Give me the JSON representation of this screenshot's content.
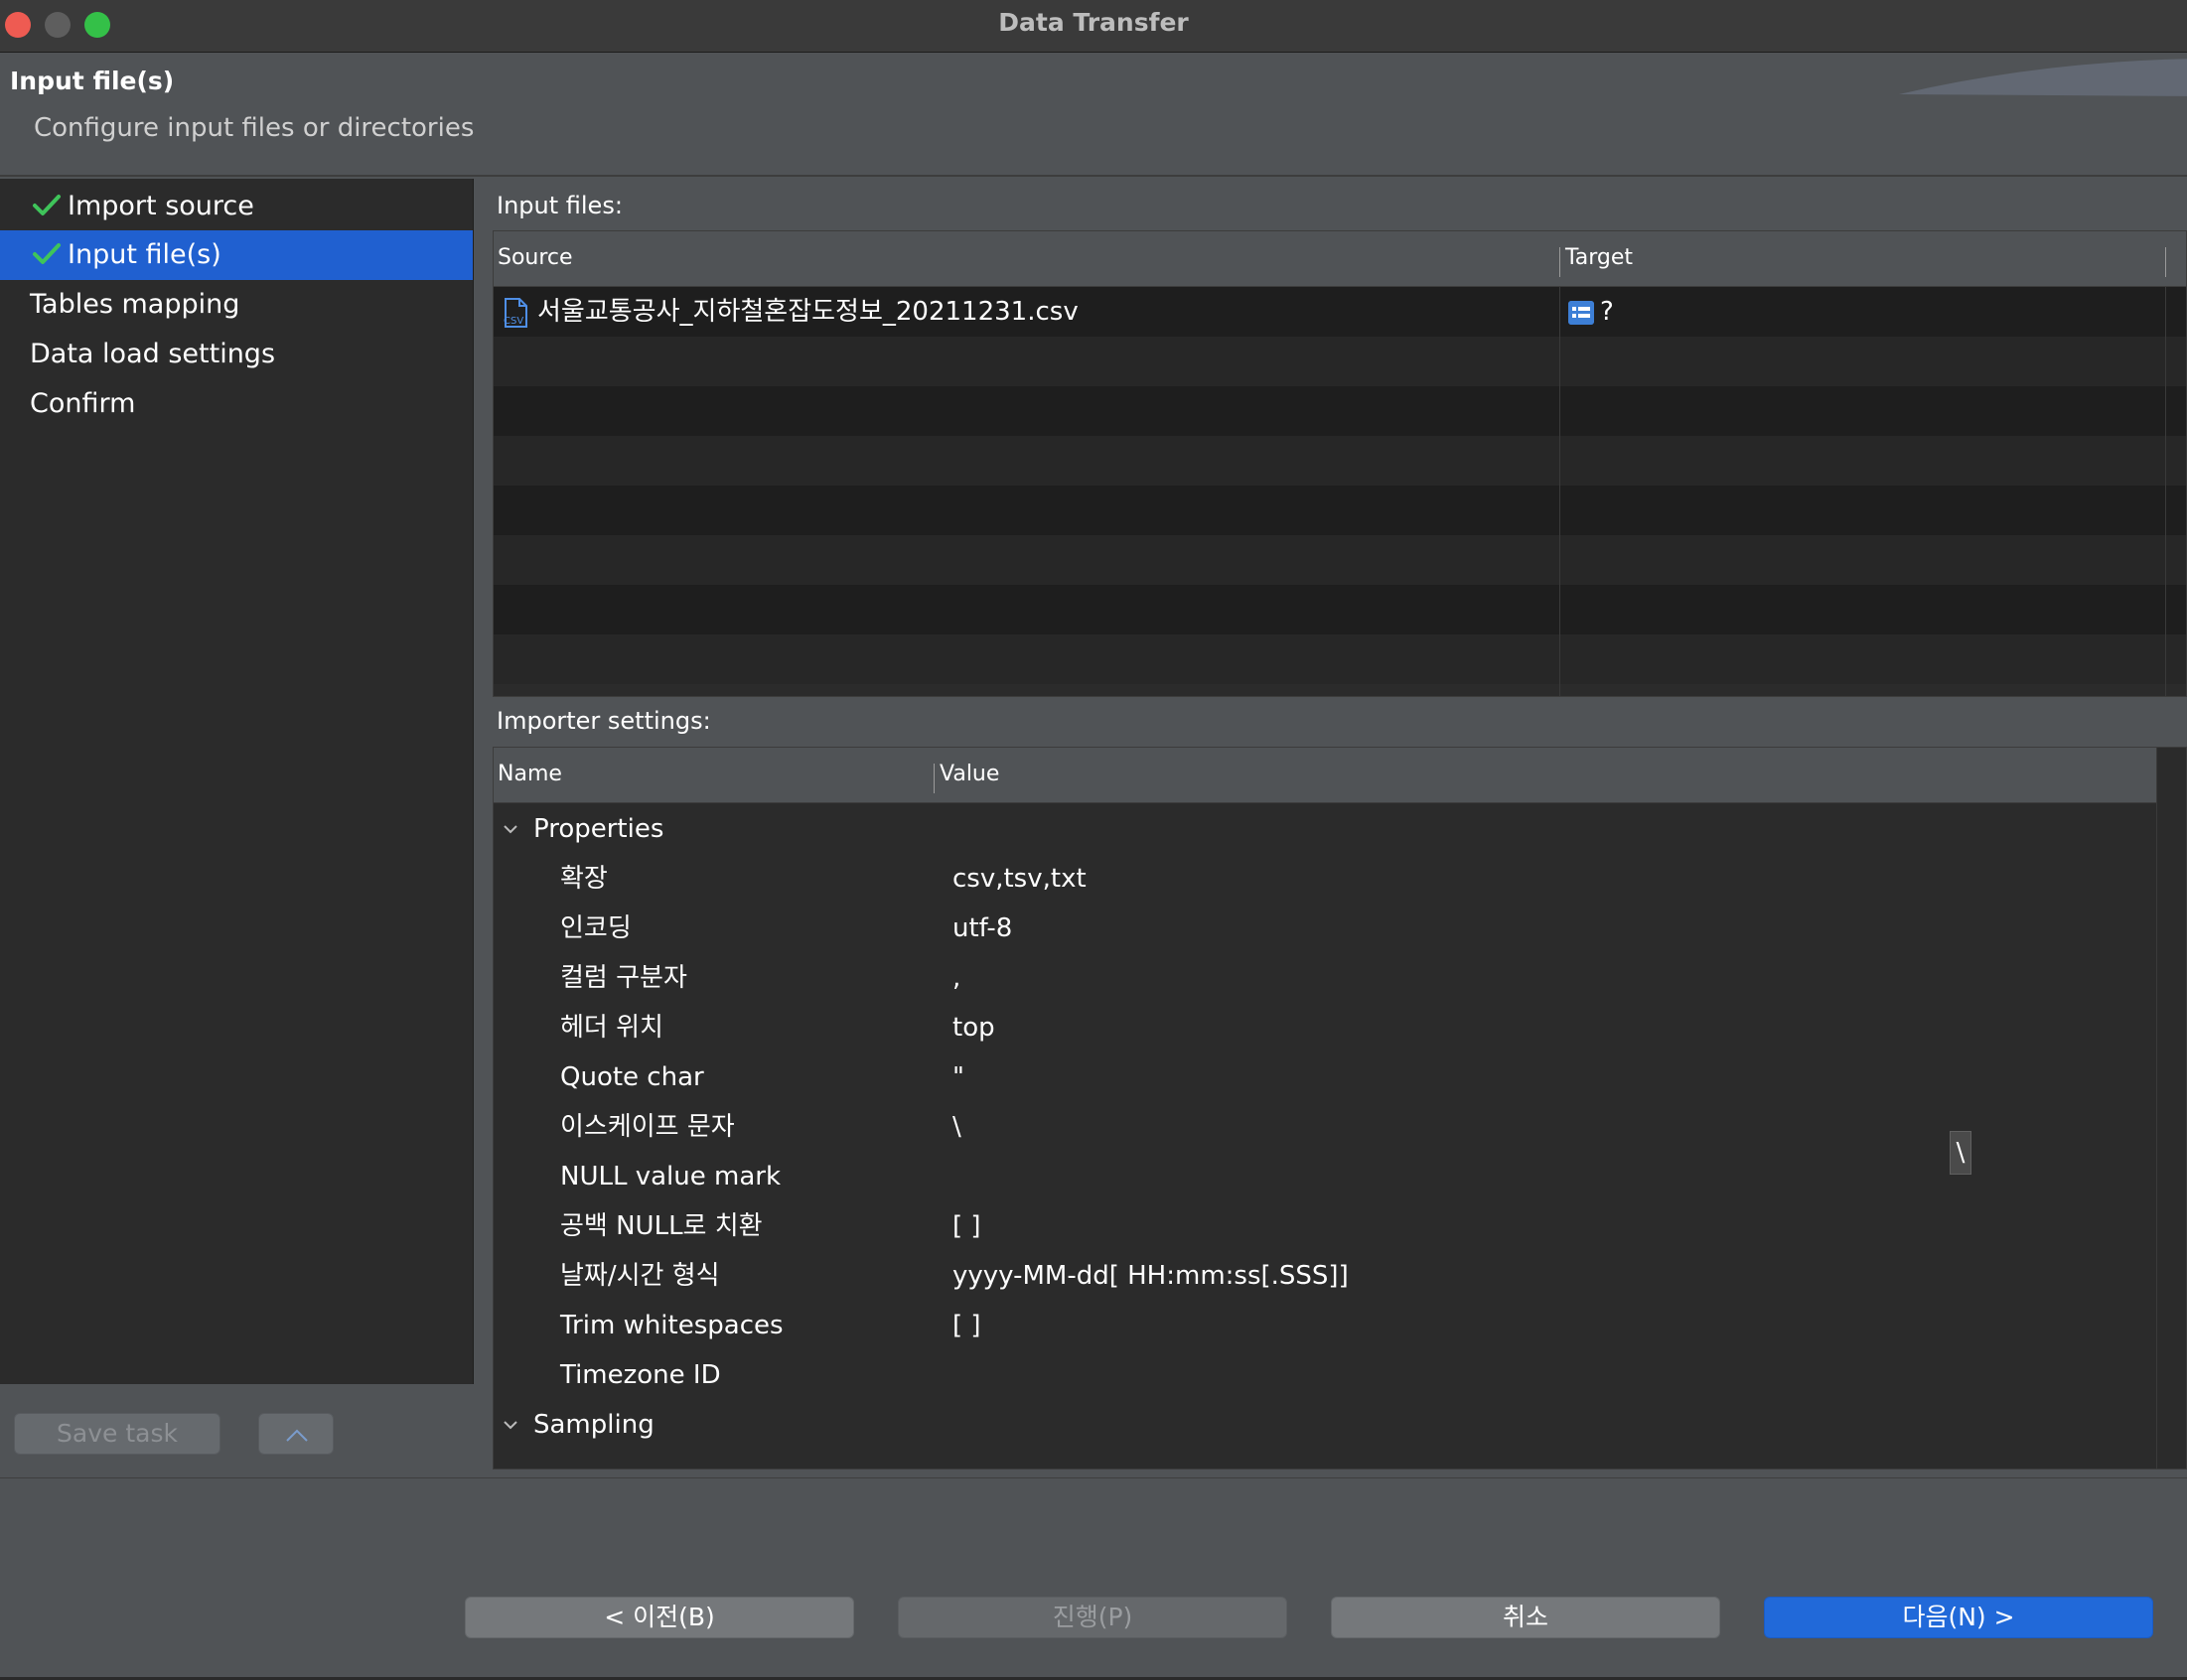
{
  "window": {
    "title": "Data Transfer"
  },
  "header": {
    "title": "Input file(s)",
    "description": "Configure input files or directories"
  },
  "nav": {
    "items": [
      {
        "label": "Import source",
        "done": true
      },
      {
        "label": "Input file(s)",
        "done": true,
        "active": true
      },
      {
        "label": "Tables mapping"
      },
      {
        "label": "Data load settings"
      },
      {
        "label": "Confirm"
      }
    ],
    "save_task_label": "Save task"
  },
  "input_files": {
    "section_label": "Input files:",
    "columns": {
      "source": "Source",
      "target": "Target"
    },
    "rows": [
      {
        "source": "서울교통공사_지하철혼잡도정보_20211231.csv",
        "target": "?"
      }
    ]
  },
  "importer": {
    "section_label": "Importer settings:",
    "columns": {
      "name": "Name",
      "value": "Value"
    },
    "groups": [
      {
        "name": "Properties",
        "props": [
          {
            "name": "확장",
            "value": "csv,tsv,txt"
          },
          {
            "name": "인코딩",
            "value": "utf-8"
          },
          {
            "name": "컬럼 구분자",
            "value": ","
          },
          {
            "name": "헤더 위치",
            "value": "top"
          },
          {
            "name": "Quote char",
            "value": "\""
          },
          {
            "name": "이스케이프 문자",
            "value": "\\"
          },
          {
            "name": "NULL value mark",
            "value": ""
          },
          {
            "name": "공백 NULL로 치환",
            "value": "[ ]"
          },
          {
            "name": "날짜/시간 형식",
            "value": "yyyy-MM-dd[ HH:mm:ss[.SSS]]"
          },
          {
            "name": "Trim whitespaces",
            "value": "[ ]"
          },
          {
            "name": "Timezone ID",
            "value": ""
          }
        ]
      },
      {
        "name": "Sampling"
      }
    ],
    "escape_editor_value": "\\"
  },
  "footer": {
    "back_label": "< 이전(B)",
    "proceed_label": "진행(P)",
    "cancel_label": "취소",
    "next_label": "다음(N) >"
  },
  "colors": {
    "accent": "#2060d0",
    "check": "#3fc45a",
    "close": "#ee5b52",
    "maximize": "#34c048"
  }
}
